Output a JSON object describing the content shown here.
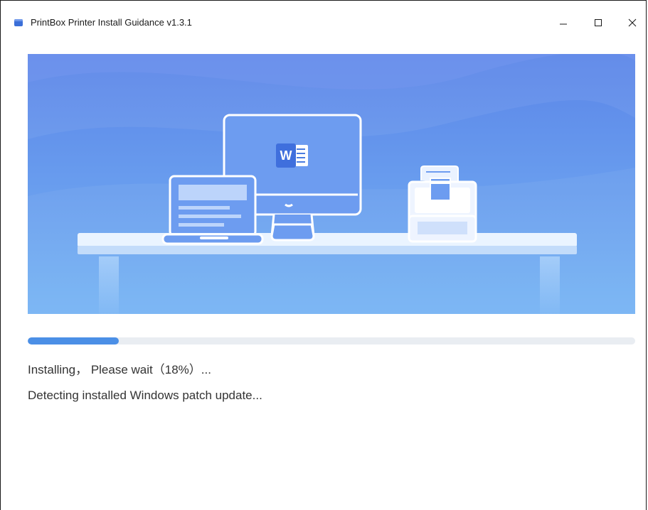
{
  "window": {
    "title": "PrintBox Printer Install Guidance v1.3.1",
    "controls": {
      "minimize": "minimize",
      "maximize": "maximize",
      "close": "close"
    }
  },
  "install": {
    "progress_fraction": 0.15,
    "status_text": "Installing， Please wait（18%）...",
    "detail_text": "Detecting installed Windows patch update..."
  },
  "colors": {
    "banner_top": "#5b85e8",
    "banner_bottom": "#76b4f4",
    "progress_fill": "#4b8fe6",
    "progress_track": "#e9edf2"
  }
}
